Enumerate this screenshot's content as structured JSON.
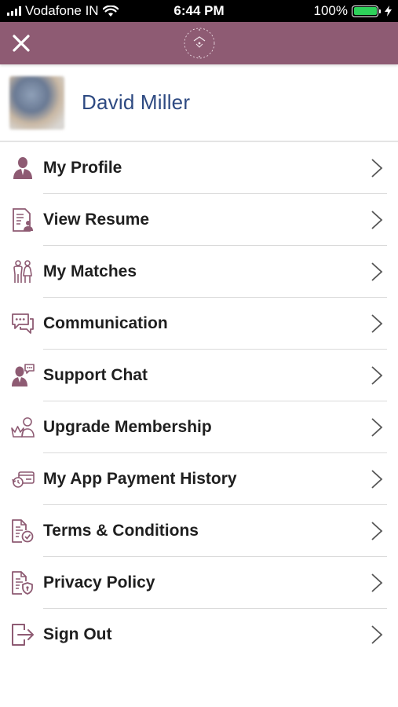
{
  "status_bar": {
    "carrier": "Vodafone IN",
    "time": "6:44 PM",
    "battery": "100%",
    "signal_icon": "signal-bars-icon",
    "wifi_icon": "wifi-icon",
    "battery_icon": "battery-full-icon",
    "charging_icon": "charging-bolt-icon"
  },
  "header": {
    "close_icon": "close-icon",
    "logo_icon": "brand-logo-icon",
    "background_color": "#8e5b73"
  },
  "profile": {
    "name": "David Miller"
  },
  "menu": {
    "items": [
      {
        "label": "My Profile",
        "icon": "user-profile-icon"
      },
      {
        "label": "View Resume",
        "icon": "resume-document-icon"
      },
      {
        "label": "My Matches",
        "icon": "couple-icon"
      },
      {
        "label": "Communication",
        "icon": "chat-bubbles-icon"
      },
      {
        "label": "Support Chat",
        "icon": "support-agent-icon"
      },
      {
        "label": "Upgrade Membership",
        "icon": "crown-user-icon"
      },
      {
        "label": "My App Payment History",
        "icon": "payment-history-icon"
      },
      {
        "label": "Terms & Conditions",
        "icon": "document-check-icon"
      },
      {
        "label": "Privacy Policy",
        "icon": "document-shield-icon"
      },
      {
        "label": "Sign Out",
        "icon": "sign-out-icon"
      }
    ],
    "chevron_icon": "chevron-right-icon",
    "icon_color": "#8e5b73"
  }
}
